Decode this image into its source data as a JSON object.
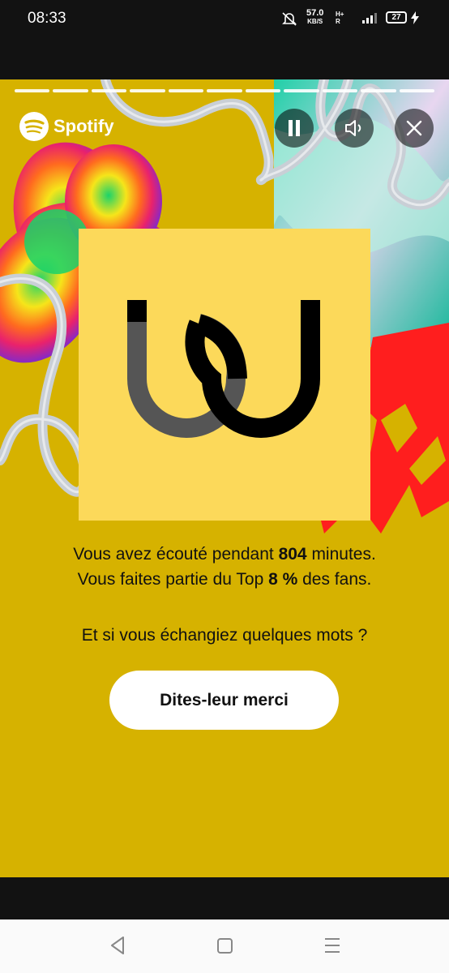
{
  "status_bar": {
    "time": "08:33",
    "net_speed": "57.0",
    "net_unit": "KB/S",
    "network_type": "H+",
    "network_sub": "R",
    "battery": "27"
  },
  "story": {
    "brand": "Spotify",
    "progress_segments": 11,
    "colors": {
      "background": "#d6b200",
      "cover": "#fcd95a",
      "button": "#ffffff"
    },
    "stats_prefix": "Vous avez écouté pendant ",
    "minutes": "804",
    "stats_mid": " minutes.",
    "top_prefix": "Vous faites partie du Top ",
    "top_percent": "8 %",
    "top_suffix": " des fans.",
    "question": "Et si vous échangiez quelques mots ?",
    "cta_label": "Dites-leur merci",
    "icons": [
      "pause-icon",
      "volume-icon",
      "close-icon"
    ]
  },
  "navigation": {
    "icons": [
      "back-icon",
      "home-icon",
      "recents-icon"
    ]
  }
}
